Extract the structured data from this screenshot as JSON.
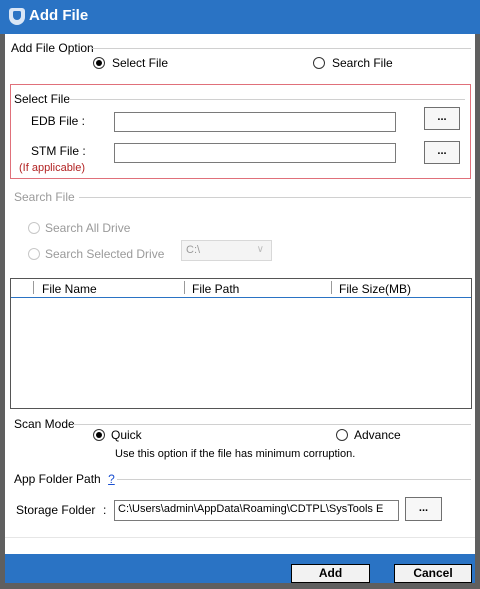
{
  "window": {
    "title": "Add File",
    "icon": "shield-icon"
  },
  "add_file_option": {
    "legend": "Add File Option",
    "select_file_label": "Select File",
    "search_file_label": "Search File",
    "selected": "select_file"
  },
  "select_file": {
    "legend": "Select File",
    "edb_label": "EDB File :",
    "edb_value": "",
    "edb_browse": "...",
    "stm_label": "STM File :",
    "stm_note": "(If applicable)",
    "stm_value": "",
    "stm_browse": "..."
  },
  "search_file": {
    "legend": "Search File",
    "search_all_label": "Search All Drive",
    "search_selected_label": "Search Selected Drive",
    "drive_value": "C:\\"
  },
  "file_table": {
    "columns": [
      "File Name",
      "File Path",
      "File Size(MB)"
    ],
    "rows": []
  },
  "scan_mode": {
    "legend": "Scan Mode",
    "quick_label": "Quick",
    "advance_label": "Advance",
    "selected": "quick",
    "hint": "Use this option if the file has minimum corruption."
  },
  "app_folder": {
    "legend": "App Folder Path",
    "help_text": "?",
    "storage_label": "Storage Folder",
    "colon": ":",
    "storage_value": "C:\\Users\\admin\\AppData\\Roaming\\CDTPL\\SysTools E",
    "browse": "..."
  },
  "footer": {
    "add_label": "Add",
    "cancel_label": "Cancel"
  },
  "colors": {
    "title_bar": "#2a73c4",
    "highlight_border": "#e0707a",
    "note_text": "#b22222"
  }
}
